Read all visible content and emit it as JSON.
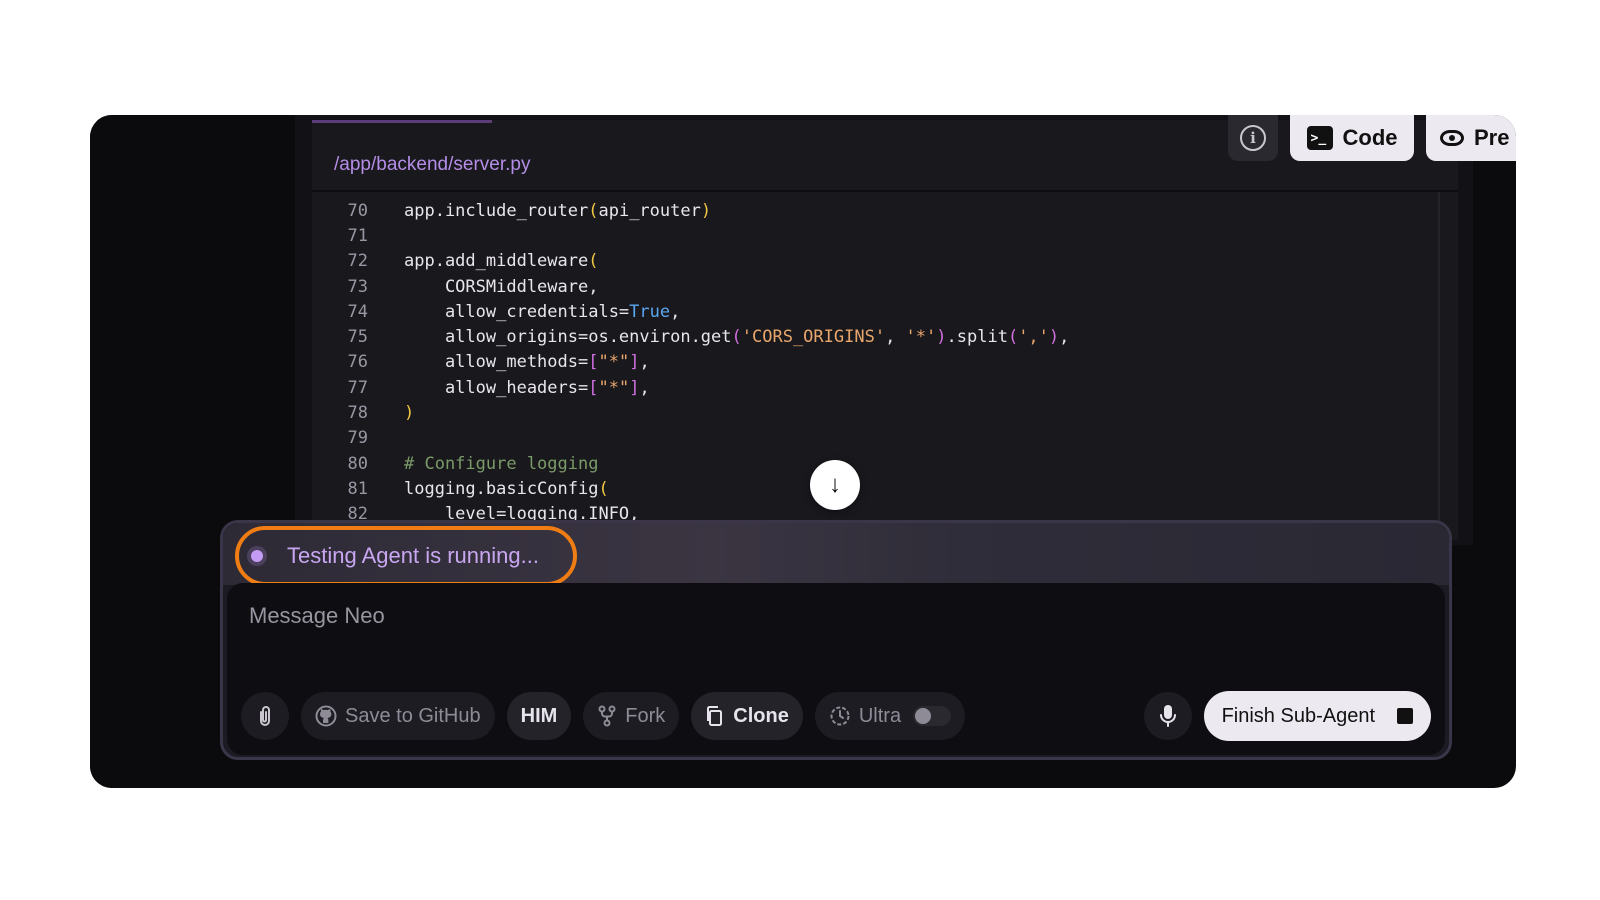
{
  "editor": {
    "file_path": "/app/backend/server.py",
    "lines": [
      {
        "n": "70",
        "text": "app.include_router(api_router)"
      },
      {
        "n": "71",
        "text": ""
      },
      {
        "n": "72",
        "text": "app.add_middleware("
      },
      {
        "n": "73",
        "text": "    CORSMiddleware,"
      },
      {
        "n": "74",
        "text": "    allow_credentials=True,"
      },
      {
        "n": "75",
        "text": "    allow_origins=os.environ.get('CORS_ORIGINS', '*').split(','),"
      },
      {
        "n": "76",
        "text": "    allow_methods=[\"*\"],"
      },
      {
        "n": "77",
        "text": "    allow_headers=[\"*\"],"
      },
      {
        "n": "78",
        "text": ")"
      },
      {
        "n": "79",
        "text": ""
      },
      {
        "n": "80",
        "text": "# Configure logging"
      },
      {
        "n": "81",
        "text": "logging.basicConfig("
      },
      {
        "n": "82",
        "text": "    level=logging.INFO,"
      }
    ]
  },
  "top_tabs": {
    "code_label": "Code",
    "preview_label": "Pre"
  },
  "status": {
    "text": "Testing Agent is running..."
  },
  "composer": {
    "placeholder": "Message Neo",
    "save_github_label": "Save to GitHub",
    "him_label": "HIM",
    "fork_label": "Fork",
    "clone_label": "Clone",
    "ultra_label": "Ultra",
    "finish_label": "Finish Sub-Agent"
  },
  "colors": {
    "accent_orange": "#f07d14",
    "status_purple": "#c8a6f0"
  },
  "icons": [
    "info-icon",
    "terminal-icon",
    "eye-icon",
    "arrow-down-icon",
    "paperclip-icon",
    "github-icon",
    "fork-icon",
    "clone-icon",
    "clock-icon",
    "microphone-icon",
    "stop-icon"
  ]
}
